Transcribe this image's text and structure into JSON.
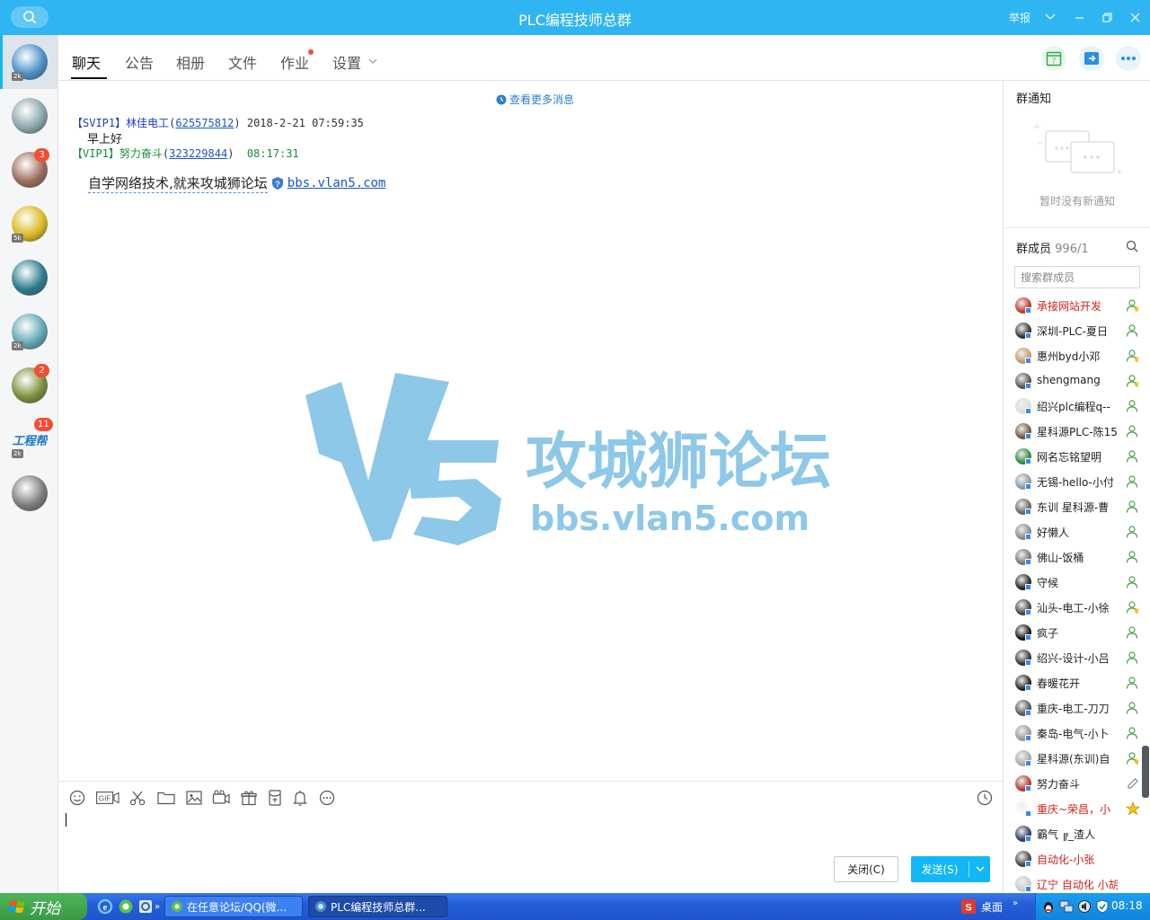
{
  "window": {
    "title": "PLC编程技师总群",
    "report_label": "举报"
  },
  "sessions": [
    {
      "name": "session-plc-group",
      "badge": "",
      "tag": "2k",
      "active": true,
      "color": "#4a8fc9"
    },
    {
      "name": "session-2",
      "badge": "",
      "tag": "",
      "color": "#8aa5ad"
    },
    {
      "name": "session-3",
      "badge": "3",
      "tag": "",
      "color": "#9a6c5a"
    },
    {
      "name": "session-4",
      "badge": "",
      "tag": "5k",
      "color": "#d9b820"
    },
    {
      "name": "session-5",
      "badge": "",
      "tag": "",
      "color": "#2a7a8c"
    },
    {
      "name": "session-6",
      "badge": "",
      "tag": "2k",
      "color": "#5fa6b5"
    },
    {
      "name": "session-7",
      "badge": "2",
      "tag": "",
      "color": "#7a8f3a"
    },
    {
      "name": "session-gongchengbang",
      "badge": "11",
      "tag": "2k",
      "text": "工程帮",
      "color": "#1d76c9"
    },
    {
      "name": "session-9",
      "badge": "",
      "tag": "",
      "color": "#7c7c7c"
    }
  ],
  "tabs": [
    "聊天",
    "公告",
    "相册",
    "文件",
    "作业",
    "设置"
  ],
  "chat": {
    "more_messages": "查看更多消息",
    "msg1": {
      "title": "【SVIP1】",
      "name": "林佳电工",
      "qq": "625575812",
      "time": "2018-2-21 07:59:35",
      "body": "早上好"
    },
    "msg2": {
      "title": "【VIP1】",
      "name": "努力奋斗",
      "qq": "323229844",
      "time": "08:17:31"
    },
    "big_text": "自学网络技术,就来攻城狮论坛",
    "big_link": "bbs.vlan5.com"
  },
  "watermark": {
    "brand": "攻城狮论坛",
    "url": "bbs.vlan5.com",
    "color": "#8ec8e8"
  },
  "input": {
    "close_label": "关闭(C)",
    "send_label": "发送(S)"
  },
  "panel": {
    "notice_heading": "群通知",
    "notice_empty": "暂时没有新通知",
    "members_label": "群成员",
    "members_count": "996/1",
    "search_placeholder": "搜索群成员"
  },
  "members": [
    {
      "name": "承接网站开发",
      "red": true,
      "role": "admin",
      "color": "#c0392b"
    },
    {
      "name": "深圳-PLC-夏日",
      "red": false,
      "role": "member",
      "color": "#333"
    },
    {
      "name": "惠州byd小邓",
      "red": false,
      "role": "admin",
      "color": "#c49a6c"
    },
    {
      "name": "shengmang",
      "red": false,
      "role": "admin",
      "color": "#555"
    },
    {
      "name": "绍兴plc编程q--",
      "red": false,
      "role": "member",
      "color": "#ddd"
    },
    {
      "name": "星科源PLC-陈15",
      "red": false,
      "role": "member",
      "color": "#6b5a3a"
    },
    {
      "name": "网名忘铭望明",
      "red": false,
      "role": "member",
      "color": "#2c8c3a"
    },
    {
      "name": "无锡-hello-小付",
      "red": false,
      "role": "member",
      "color": "#8899aa"
    },
    {
      "name": "东训 星科源-曹",
      "red": false,
      "role": "member",
      "color": "#666"
    },
    {
      "name": "好懒人",
      "red": false,
      "role": "member",
      "color": "#888"
    },
    {
      "name": "佛山-饭桶",
      "red": false,
      "role": "member",
      "color": "#777"
    },
    {
      "name": "守候",
      "red": false,
      "role": "member",
      "color": "#222"
    },
    {
      "name": "汕头-电工-小徐",
      "red": false,
      "role": "admin",
      "color": "#444"
    },
    {
      "name": "疯子",
      "red": false,
      "role": "member",
      "color": "#111"
    },
    {
      "name": "绍兴-设计-小吕",
      "red": false,
      "role": "member",
      "color": "#333"
    },
    {
      "name": "春暖花开",
      "red": false,
      "role": "member",
      "color": "#222"
    },
    {
      "name": "重庆-电工-刀刀",
      "red": false,
      "role": "member",
      "color": "#555"
    },
    {
      "name": "秦岛-电气-小卜",
      "red": false,
      "role": "member",
      "color": "#999"
    },
    {
      "name": "星科源(东训)自",
      "red": false,
      "role": "admin",
      "color": "#aaa"
    },
    {
      "name": "努力奋斗",
      "red": false,
      "role": "edit",
      "color": "#b83a2a"
    },
    {
      "name": "重庆~荣昌，小",
      "red": true,
      "role": "owner",
      "color": "#ffffff"
    },
    {
      "name": "霸气 ╔_渣人",
      "red": false,
      "role": "none",
      "color": "#2a3b5c"
    },
    {
      "name": "自动化-小张",
      "red": true,
      "role": "none",
      "color": "#444"
    },
    {
      "name": "辽宁 自动化 小胡",
      "red": true,
      "role": "none",
      "color": "#ccc"
    }
  ],
  "taskbar": {
    "start_label": "开始",
    "task1": "在任意论坛/QQ(微...",
    "task2": "PLC编程技师总群...",
    "desktop_label": "桌面",
    "clock": "08:18"
  }
}
